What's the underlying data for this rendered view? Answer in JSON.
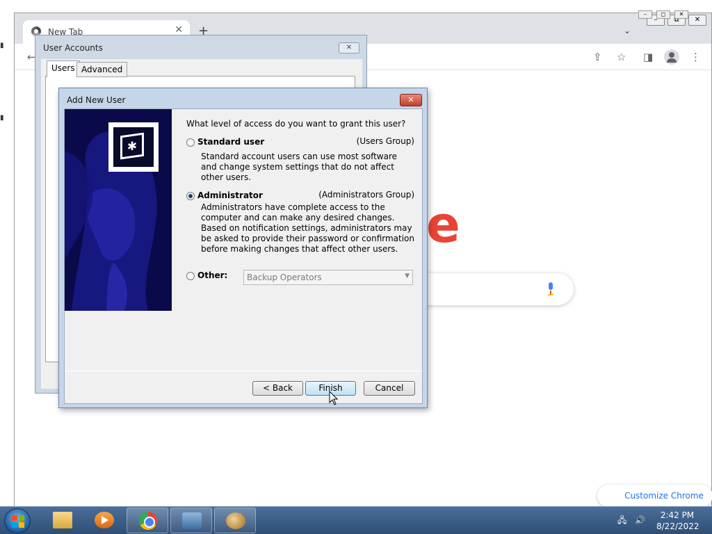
{
  "browser": {
    "tab_title": "New Tab",
    "new_tab_symbol": "+",
    "tab_close_symbol": "✕",
    "tab_search_symbol": "⌄",
    "customize_label": "Customize Chrome",
    "logo_fragment": "e",
    "window_controls": [
      "–",
      "◻",
      "✕"
    ]
  },
  "outer_window_controls": [
    "–",
    "⧉",
    "✕"
  ],
  "user_accounts": {
    "title": "User Accounts",
    "close_symbol": "✕",
    "tabs": [
      "Users",
      "Advanced"
    ]
  },
  "dialog": {
    "title": "Add New User",
    "close_symbol": "✕",
    "question": "What level of access do you want to grant this user?",
    "options": [
      {
        "label": "Standard user",
        "group": "(Users Group)",
        "description": "Standard account users can use most software and change system settings that do not affect other users.",
        "checked": false
      },
      {
        "label": "Administrator",
        "group": "(Administrators Group)",
        "description": "Administrators have complete access to the computer and can make any desired changes. Based on notification settings, administrators may be asked to provide their password or confirmation before making changes that affect other users.",
        "checked": true
      },
      {
        "label": "Other:",
        "group": "",
        "description": "",
        "checked": false
      }
    ],
    "other_select": {
      "value": "Backup Operators",
      "disabled": true
    },
    "buttons": {
      "back": "< Back",
      "finish": "Finish",
      "cancel": "Cancel"
    }
  },
  "taskbar": {
    "apps": [
      {
        "name": "windows-explorer",
        "icon": "folder-icon"
      },
      {
        "name": "windows-media-player",
        "icon": "media-player-icon"
      },
      {
        "name": "google-chrome",
        "icon": "chrome-icon"
      },
      {
        "name": "network-settings",
        "icon": "network-app-icon"
      },
      {
        "name": "user-accounts",
        "icon": "users-app-icon"
      }
    ],
    "time": "2:42 PM",
    "date": "8/22/2022"
  },
  "colors": {
    "banner_bg": "#0a0a4a",
    "google_red": "#ea4335",
    "link_blue": "#1a73e8",
    "dialog_close": "#c2402b",
    "taskbar": "#3a5c85"
  }
}
